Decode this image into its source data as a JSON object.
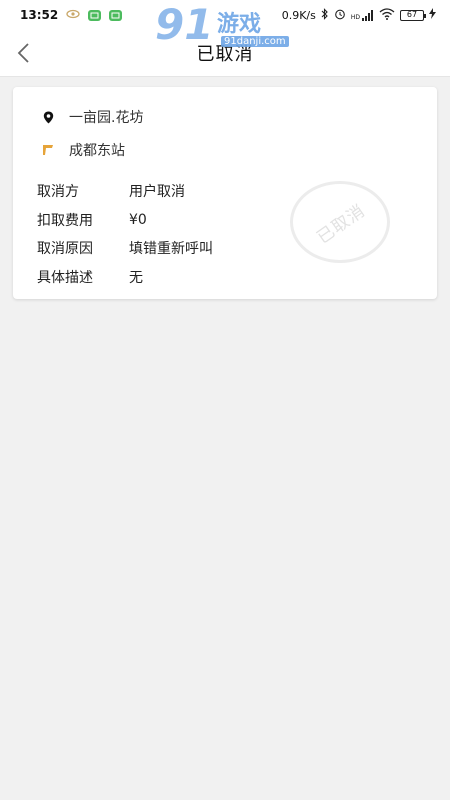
{
  "status_bar": {
    "time": "13:52",
    "net_speed": "0.9K/s",
    "signal_label": "HD",
    "battery_level": "67"
  },
  "watermark": {
    "brand_number": "91",
    "brand_text": "游戏",
    "brand_url": "91danji.com"
  },
  "header": {
    "title": "已取消"
  },
  "route": {
    "start": "一亩园.花坊",
    "end": "成都东站"
  },
  "details": [
    {
      "label": "取消方",
      "value": "用户取消"
    },
    {
      "label": "扣取费用",
      "value": "¥0"
    },
    {
      "label": "取消原因",
      "value": "填错重新呼叫"
    },
    {
      "label": "具体描述",
      "value": "无"
    }
  ],
  "stamp": {
    "text": "已取消"
  },
  "colors": {
    "start_pin": "#111111",
    "end_flag": "#e6a43a",
    "battery": "#6cc04a"
  }
}
